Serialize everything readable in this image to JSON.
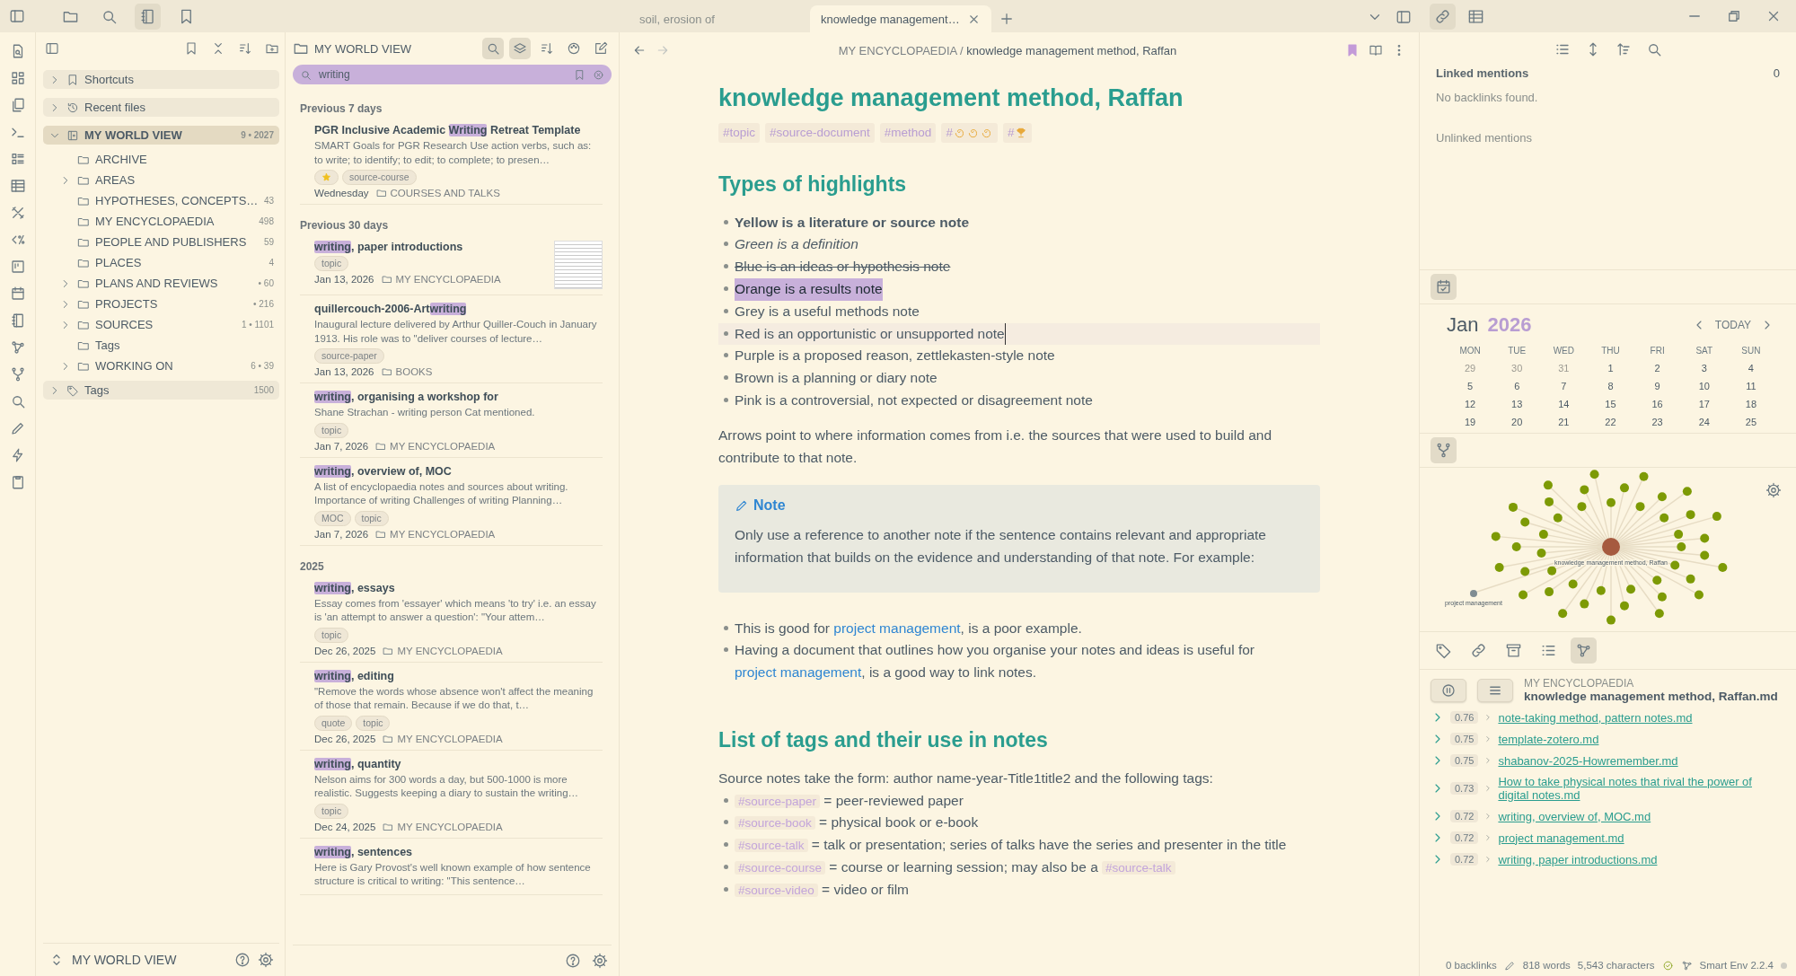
{
  "topbar": {
    "left_tabs": [
      {
        "kind": "folder",
        "selected": false
      },
      {
        "kind": "search",
        "selected": false
      },
      {
        "kind": "book",
        "selected": true
      },
      {
        "kind": "bookmark",
        "selected": false
      }
    ],
    "tabs": [
      {
        "title": "soil, erosion of",
        "selected": false
      },
      {
        "title": "knowledge management…",
        "selected": true
      }
    ],
    "right_tabs": [
      {
        "kind": "link",
        "selected": true
      },
      {
        "kind": "table",
        "selected": false
      }
    ]
  },
  "files": {
    "items": [
      {
        "label": "Shortcuts",
        "kind": "bookmark",
        "collapsible": true,
        "expanded": false,
        "selected": false
      },
      {
        "label": "Recent files",
        "kind": "history",
        "collapsible": true,
        "expanded": false,
        "selected": false
      },
      {
        "label": "MY WORLD VIEW",
        "kind": "vault",
        "collapsible": true,
        "expanded": true,
        "selected": true,
        "count": "9 • 2027",
        "children": [
          {
            "label": "ARCHIVE",
            "kind": "folder",
            "collapsible": false,
            "selected": false
          },
          {
            "label": "AREAS",
            "kind": "folder",
            "collapsible": true,
            "expanded": false,
            "selected": false
          },
          {
            "label": "HYPOTHESES, CONCEPTS…",
            "kind": "folder",
            "collapsible": false,
            "selected": false,
            "count": "43"
          },
          {
            "label": "MY ENCYCLOPAEDIA",
            "kind": "folder",
            "collapsible": false,
            "selected": false,
            "count": "498"
          },
          {
            "label": "PEOPLE AND PUBLISHERS",
            "kind": "folder",
            "collapsible": false,
            "selected": false,
            "count": "59"
          },
          {
            "label": "PLACES",
            "kind": "folder",
            "collapsible": false,
            "selected": false,
            "count": "4"
          },
          {
            "label": "PLANS AND REVIEWS",
            "kind": "folder",
            "collapsible": true,
            "expanded": false,
            "selected": false,
            "count": "• 60"
          },
          {
            "label": "PROJECTS",
            "kind": "folder",
            "collapsible": true,
            "expanded": false,
            "selected": false,
            "count": "• 216"
          },
          {
            "label": "SOURCES",
            "kind": "folder",
            "collapsible": true,
            "expanded": false,
            "selected": false,
            "count": "1 • 1101"
          },
          {
            "label": "Tags",
            "kind": "folder",
            "collapsible": false,
            "selected": false
          },
          {
            "label": "WORKING ON",
            "kind": "folder",
            "collapsible": true,
            "expanded": false,
            "selected": false,
            "count": "6 • 39"
          }
        ]
      },
      {
        "label": "Tags",
        "kind": "tag",
        "collapsible": true,
        "expanded": false,
        "selected": false,
        "count": "1500"
      }
    ],
    "vault": "MY WORLD VIEW"
  },
  "notes": {
    "folder": "MY WORLD VIEW",
    "tools": [
      {
        "kind": "search",
        "selected": true
      },
      {
        "kind": "layers",
        "selected": true
      },
      {
        "kind": "sort",
        "selected": false
      },
      {
        "kind": "palette",
        "selected": false
      },
      {
        "kind": "edit",
        "selected": false
      }
    ],
    "search": {
      "value": "writing"
    },
    "sections": [
      {
        "heading": "Previous 7 days",
        "notes": [
          {
            "title": [
              {
                "text": "PGR Inclusive Academic ",
                "match": false
              },
              {
                "text": "Writing",
                "match": true
              },
              {
                "text": " Retreat Template",
                "match": false
              }
            ],
            "snippet": "SMART Goals for PGR Research Use action verbs, such as: to write; to identify; to edit; to complete; to presen…",
            "starred": true,
            "tags": [
              "source-course"
            ],
            "date": "Wednesday",
            "folder": "COURSES AND TALKS",
            "thumbnail": false
          }
        ]
      },
      {
        "heading": "Previous 30 days",
        "notes": [
          {
            "title": [
              {
                "text": "writing",
                "match": true
              },
              {
                "text": ", paper introductions",
                "match": false
              }
            ],
            "starred": false,
            "tags": [
              "topic"
            ],
            "date": "Jan 13, 2026",
            "folder": "MY ENCYCLOPAEDIA",
            "thumbnail": true
          },
          {
            "title": [
              {
                "text": "quillercouch-2006-Art",
                "match": false
              },
              {
                "text": "writing",
                "match": true
              }
            ],
            "snippet": "Inaugural lecture delivered by Arthur Quiller-Couch in January 1913. His role was to \"deliver courses of lecture…",
            "starred": false,
            "tags": [
              "source-paper"
            ],
            "date": "Jan 13, 2026",
            "folder": "BOOKS",
            "thumbnail": false
          },
          {
            "title": [
              {
                "text": "writing",
                "match": true
              },
              {
                "text": ", organising a workshop for",
                "match": false
              }
            ],
            "snippet": "Shane Strachan - writing person Cat mentioned.",
            "starred": false,
            "tags": [
              "topic"
            ],
            "date": "Jan 7, 2026",
            "folder": "MY ENCYCLOPAEDIA",
            "thumbnail": false
          },
          {
            "title": [
              {
                "text": "writing",
                "match": true
              },
              {
                "text": ", overview of, MOC",
                "match": false
              }
            ],
            "snippet": "A list of encyclopaedia notes and sources about writing. Importance of writing Challenges of writing Planning…",
            "starred": false,
            "tags": [
              "MOC",
              "topic"
            ],
            "date": "Jan 7, 2026",
            "folder": "MY ENCYCLOPAEDIA",
            "thumbnail": false
          }
        ]
      },
      {
        "heading": "2025",
        "notes": [
          {
            "title": [
              {
                "text": "writing",
                "match": true
              },
              {
                "text": ", essays",
                "match": false
              }
            ],
            "snippet": "Essay comes from 'essayer' which means 'to try' i.e. an essay is 'an attempt to answer a question': \"Your attem…",
            "starred": false,
            "tags": [
              "topic"
            ],
            "date": "Dec 26, 2025",
            "folder": "MY ENCYCLOPAEDIA",
            "thumbnail": false
          },
          {
            "title": [
              {
                "text": "writing",
                "match": true
              },
              {
                "text": ", editing",
                "match": false
              }
            ],
            "snippet": "\"Remove the words whose absence won't affect the meaning of those that remain. Because if we do that, t…",
            "starred": false,
            "tags": [
              "quote",
              "topic"
            ],
            "date": "Dec 26, 2025",
            "folder": "MY ENCYCLOPAEDIA",
            "thumbnail": false
          },
          {
            "title": [
              {
                "text": "writing",
                "match": true
              },
              {
                "text": ", quantity",
                "match": false
              }
            ],
            "snippet": "Nelson aims for 300 words a day, but 500-1000 is more realistic. Suggests keeping a diary to sustain the writing…",
            "starred": false,
            "tags": [
              "topic"
            ],
            "date": "Dec 24, 2025",
            "folder": "MY ENCYCLOPAEDIA",
            "thumbnail": false
          },
          {
            "title": [
              {
                "text": "writing",
                "match": true
              },
              {
                "text": ", sentences",
                "match": false
              }
            ],
            "snippet": "Here is Gary Provost's well known example of how sentence structure is critical to writing: \"This sentence…",
            "starred": false,
            "thumbnail": false
          }
        ]
      }
    ]
  },
  "editor": {
    "breadcrumb": {
      "folder": "MY ENCYCLOPAEDIA",
      "separator": "/",
      "note": "knowledge management method, Raffan"
    },
    "title": "knowledge management method, Raffan",
    "tags": [
      {
        "text": "#topic",
        "kind": "text"
      },
      {
        "text": "#source-document",
        "kind": "text"
      },
      {
        "text": "#method",
        "kind": "text"
      },
      {
        "text": "#",
        "kind": "swirls"
      },
      {
        "text": "#",
        "kind": "trophy"
      }
    ],
    "heading1": "Types of highlights",
    "highlights": [
      {
        "text": "Yellow is a literature or source note",
        "kind": "bold",
        "active": false
      },
      {
        "text": "Green is a definition",
        "kind": "italic",
        "active": false
      },
      {
        "text": "Blue is an ideas or hypothesis note",
        "kind": "strike",
        "active": false
      },
      {
        "text": "Orange is a results note",
        "kind": "highlight",
        "active": false
      },
      {
        "text": "Grey is a useful methods note",
        "kind": "plain",
        "active": false
      },
      {
        "text": "Red is an opportunistic or unsupported note",
        "kind": "plain",
        "active": true
      },
      {
        "text": "Purple is a proposed reason, zettlekasten-style note",
        "kind": "plain",
        "active": false
      },
      {
        "text": "Brown is a planning or diary note",
        "kind": "plain",
        "active": false
      },
      {
        "text": "Pink is a controversial, not expected or disagreement note",
        "kind": "plain",
        "active": false
      }
    ],
    "paragraph": "Arrows point to where information comes from i.e. the sources that were used to build and contribute to that note.",
    "callout": {
      "title": "Note",
      "text": "Only use a reference to another note if the sentence contains relevant and appropriate information that builds on the evidence and understanding of that note. For example:"
    },
    "examples": [
      [
        {
          "kind": "text",
          "text": "This is good for "
        },
        {
          "kind": "link",
          "text": "project management"
        },
        {
          "kind": "text",
          "text": ", is a poor example."
        }
      ],
      [
        {
          "kind": "text",
          "text": "Having a document that outlines how you organise your notes and ideas is useful for "
        },
        {
          "kind": "link",
          "text": "project management"
        },
        {
          "kind": "text",
          "text": ", is a good way to link notes."
        }
      ]
    ],
    "heading2": "List of tags and their use in notes",
    "intro": "Source notes take the form: author name-year-Title1title2 and the following tags:",
    "tag_list": [
      [
        {
          "kind": "tag",
          "text": "#source-paper"
        },
        {
          "kind": "text",
          "text": " = peer-reviewed paper"
        }
      ],
      [
        {
          "kind": "tag",
          "text": "#source-book"
        },
        {
          "kind": "text",
          "text": " = physical book or e-book"
        }
      ],
      [
        {
          "kind": "tag",
          "text": "#source-talk"
        },
        {
          "kind": "text",
          "text": " = talk or presentation; series of talks have the series and presenter in the title"
        }
      ],
      [
        {
          "kind": "tag",
          "text": "#source-course"
        },
        {
          "kind": "text",
          "text": " = course or learning session; may also be a "
        },
        {
          "kind": "tag",
          "text": "#source-talk"
        }
      ],
      [
        {
          "kind": "tag",
          "text": "#source-video"
        },
        {
          "kind": "text",
          "text": " = video or film"
        }
      ]
    ]
  },
  "backlinks": {
    "linked": "Linked mentions",
    "linked_count": "0",
    "empty": "No backlinks found.",
    "unlinked": "Unlinked mentions"
  },
  "calendar": {
    "tab": {
      "selected": true
    },
    "month": "Jan",
    "year": "2026",
    "today": "TODAY",
    "weekdays": [
      "MON",
      "TUE",
      "WED",
      "THU",
      "FRI",
      "SAT",
      "SUN"
    ],
    "weeks": [
      [
        {
          "day": "29",
          "muted": true
        },
        {
          "day": "30",
          "muted": true
        },
        {
          "day": "31",
          "muted": true
        },
        {
          "day": "1",
          "muted": false
        },
        {
          "day": "2",
          "muted": false
        },
        {
          "day": "3",
          "muted": false
        },
        {
          "day": "4",
          "muted": false
        }
      ],
      [
        {
          "day": "5",
          "muted": false
        },
        {
          "day": "6",
          "muted": false
        },
        {
          "day": "7",
          "muted": false
        },
        {
          "day": "8",
          "muted": false
        },
        {
          "day": "9",
          "muted": false
        },
        {
          "day": "10",
          "muted": false
        },
        {
          "day": "11",
          "muted": false
        }
      ],
      [
        {
          "day": "12",
          "muted": false
        },
        {
          "day": "13",
          "muted": false
        },
        {
          "day": "14",
          "muted": false
        },
        {
          "day": "15",
          "muted": false
        },
        {
          "day": "16",
          "muted": false
        },
        {
          "day": "17",
          "muted": false
        },
        {
          "day": "18",
          "muted": false
        }
      ],
      [
        {
          "day": "19",
          "muted": false
        },
        {
          "day": "20",
          "muted": false
        },
        {
          "day": "21",
          "muted": false
        },
        {
          "day": "22",
          "muted": false
        },
        {
          "day": "23",
          "muted": false
        },
        {
          "day": "24",
          "muted": false
        },
        {
          "day": "25",
          "muted": false
        }
      ]
    ]
  },
  "graph": {
    "tab": {
      "selected": true
    },
    "center": "knowledge management method, Raffan",
    "side_node": "project management"
  },
  "connections": {
    "tools": [
      {
        "kind": "tag",
        "selected": false
      },
      {
        "kind": "link",
        "selected": false
      },
      {
        "kind": "archive",
        "selected": false
      },
      {
        "kind": "bullets",
        "selected": false
      },
      {
        "kind": "nodes",
        "selected": true
      }
    ],
    "folder": "MY ENCYCLOPAEDIA",
    "file": "knowledge management method, Raffan.md",
    "results": [
      {
        "score": "0.76",
        "name": "note-taking method, pattern notes.md"
      },
      {
        "score": "0.75",
        "name": "template-zotero.md"
      },
      {
        "score": "0.75",
        "name": "shabanov-2025-Howremember.md"
      },
      {
        "score": "0.73",
        "name": "How to take physical notes that rival the power of digital notes.md"
      },
      {
        "score": "0.72",
        "name": "writing, overview of, MOC.md"
      },
      {
        "score": "0.72",
        "name": "project management.md"
      },
      {
        "score": "0.72",
        "name": "writing, paper introductions.md"
      }
    ]
  },
  "status": {
    "backlinks": "0 backlinks",
    "words": "818 words",
    "characters": "5,543 characters",
    "plugin": "Smart Env 2.2.4"
  }
}
